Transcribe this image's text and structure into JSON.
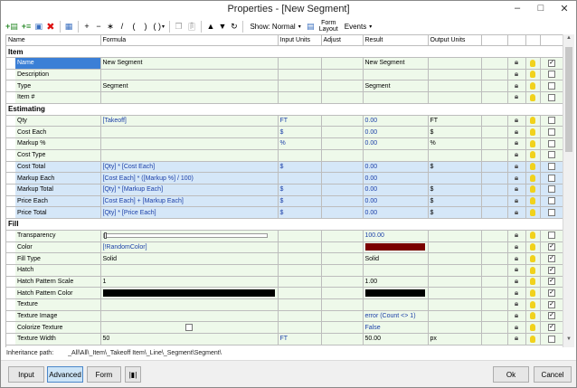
{
  "window": {
    "title": "Properties - [New Segment]"
  },
  "toolbar": {
    "show_label": "Show: Normal",
    "form_layout_line1": "Form",
    "form_layout_line2": "Layout",
    "events_label": "Events",
    "op_plus": "+",
    "op_minus": "−",
    "op_times": "∗",
    "op_div": "/",
    "op_lparen": "(",
    "op_rparen": ")",
    "op_parens": "( )"
  },
  "columns": [
    "Name",
    "Formula",
    "Input Units",
    "Adjust",
    "Result",
    "Output Units"
  ],
  "sections": {
    "item": "Item",
    "estimating": "Estimating",
    "fill": "Fill"
  },
  "rows": {
    "item": [
      {
        "name": "Name",
        "formula": "New Segment",
        "input_units": "",
        "result": "New Segment",
        "output_units": "",
        "checked": true
      },
      {
        "name": "Description",
        "formula": "",
        "input_units": "",
        "result": "",
        "output_units": "",
        "checked": false
      },
      {
        "name": "Type",
        "formula": "Segment",
        "input_units": "",
        "result": "Segment",
        "output_units": "",
        "checked": false
      },
      {
        "name": "Item #",
        "formula": "",
        "input_units": "",
        "result": "",
        "output_units": "",
        "checked": false
      }
    ],
    "estimating": [
      {
        "name": "Qty",
        "formula": "[Takeoff]",
        "input_units": "FT",
        "result": "0.00",
        "output_units": "FT"
      },
      {
        "name": "Cost Each",
        "formula": "",
        "input_units": "$",
        "result": "0.00",
        "output_units": "$"
      },
      {
        "name": "Markup %",
        "formula": "",
        "input_units": "%",
        "result": "0.00",
        "output_units": "%"
      },
      {
        "name": "Cost Type",
        "formula": "",
        "input_units": "",
        "result": "",
        "output_units": ""
      },
      {
        "name": "Cost Total",
        "formula": "[Qty] * [Cost Each]",
        "input_units": "$",
        "result": "0.00",
        "output_units": "$"
      },
      {
        "name": "Markup Each",
        "formula": "[Cost Each] * ([Markup %] / 100)",
        "input_units": "",
        "result": "0.00",
        "output_units": ""
      },
      {
        "name": "Markup Total",
        "formula": "[Qty] * [Markup Each]",
        "input_units": "$",
        "result": "0.00",
        "output_units": "$"
      },
      {
        "name": "Price Each",
        "formula": "[Cost Each] + [Markup Each]",
        "input_units": "$",
        "result": "0.00",
        "output_units": "$"
      },
      {
        "name": "Price Total",
        "formula": "[Qty] * [Price Each]",
        "input_units": "$",
        "result": "0.00",
        "output_units": "$"
      }
    ],
    "fill": [
      {
        "name": "Transparency",
        "formula": "",
        "input_units": "",
        "result": "100.00",
        "output_units": "",
        "checked": false
      },
      {
        "name": "Color",
        "formula": "[!RandomColor]",
        "input_units": "",
        "result": "",
        "output_units": "",
        "checked": true
      },
      {
        "name": "Fill Type",
        "formula": "Solid",
        "input_units": "",
        "result": "Solid",
        "output_units": "",
        "checked": true
      },
      {
        "name": "Hatch",
        "formula": "",
        "input_units": "",
        "result": "",
        "output_units": "",
        "checked": true
      },
      {
        "name": "Hatch Pattern Scale",
        "formula": "1",
        "input_units": "",
        "result": "1.00",
        "output_units": "",
        "checked": true
      },
      {
        "name": "Hatch Pattern Color",
        "formula": "",
        "input_units": "",
        "result": "",
        "output_units": "",
        "checked": true
      },
      {
        "name": "Texture",
        "formula": "",
        "input_units": "",
        "result": "",
        "output_units": "",
        "checked": true
      },
      {
        "name": "Texture Image",
        "formula": "",
        "input_units": "",
        "result": "error (Count <> 1)",
        "output_units": "",
        "checked": true
      },
      {
        "name": "Colorize Texture",
        "formula": "",
        "input_units": "",
        "result": "False",
        "output_units": "",
        "checked": true
      },
      {
        "name": "Texture Width",
        "formula": "50",
        "input_units": "FT",
        "result": "50.00",
        "output_units": "px",
        "checked": false
      }
    ]
  },
  "colors": {
    "color_swatch": "#7a0000",
    "hatch_pattern_swatch": "#000000",
    "green_row": "#eef9ea",
    "blue_row": "#d5e7f8",
    "selected": "#3b7fd6"
  },
  "transparency_level": 0,
  "status": {
    "label": "Inheritance path:",
    "path": "_All\\All\\_Item\\_Takeoff Item\\_Line\\_Segment\\Segment\\"
  },
  "buttons": {
    "input": "Input",
    "advanced": "Advanced",
    "form": "Form",
    "ok": "Ok",
    "cancel": "Cancel"
  }
}
